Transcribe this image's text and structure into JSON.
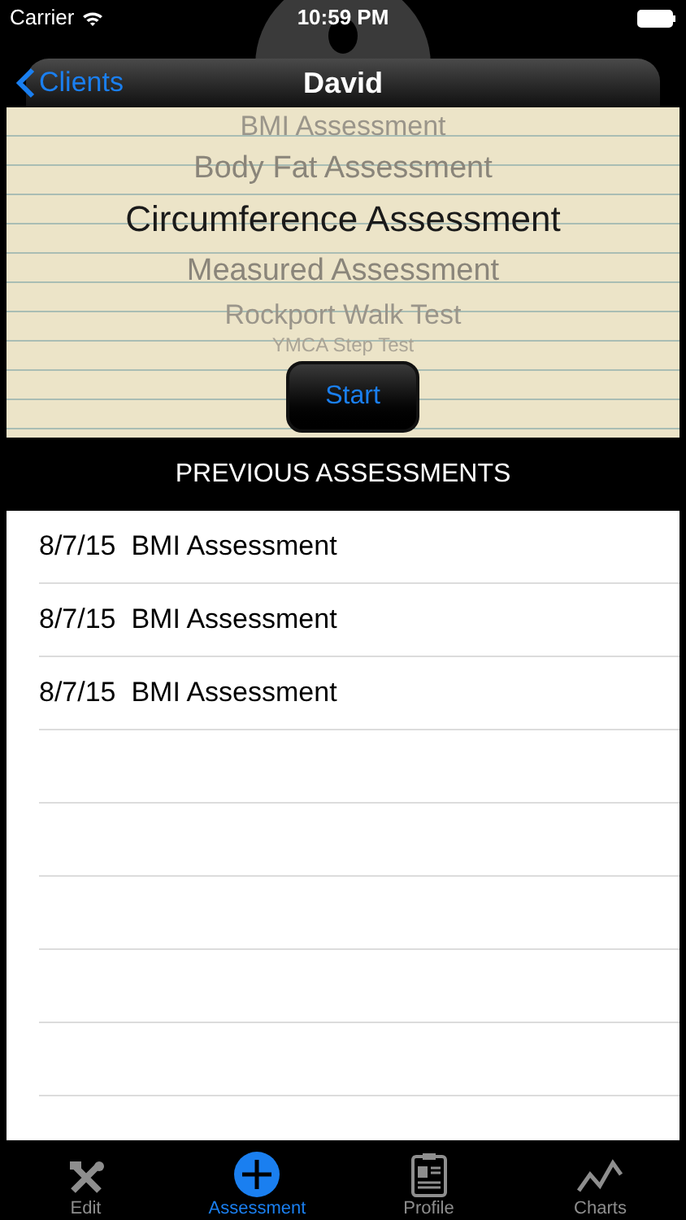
{
  "status_bar": {
    "carrier": "Carrier",
    "time": "10:59 PM"
  },
  "nav_bar": {
    "back": "Clients",
    "title": "David"
  },
  "picker": {
    "items": [
      {
        "label": "BMI Assessment",
        "selected": false
      },
      {
        "label": "Body Fat Assessment",
        "selected": false
      },
      {
        "label": "Circumference Assessment",
        "selected": true
      },
      {
        "label": "Measured Assessment",
        "selected": false
      },
      {
        "label": "Rockport Walk Test",
        "selected": false
      },
      {
        "label": "YMCA Step Test",
        "selected": false
      }
    ],
    "button": "Start"
  },
  "section_title": "PREVIOUS ASSESSMENTS",
  "assessments": [
    {
      "date": "8/7/15",
      "name": "BMI Assessment"
    },
    {
      "date": "8/7/15",
      "name": "BMI Assessment"
    },
    {
      "date": "8/7/15",
      "name": "BMI Assessment"
    }
  ],
  "tab_bar": [
    {
      "kind": "tools",
      "label": "Edit",
      "selected": false
    },
    {
      "kind": "add",
      "label": "Assessment",
      "selected": true
    },
    {
      "kind": "profile",
      "label": "Profile",
      "selected": false
    },
    {
      "kind": "chart",
      "label": "Charts",
      "selected": false
    }
  ]
}
